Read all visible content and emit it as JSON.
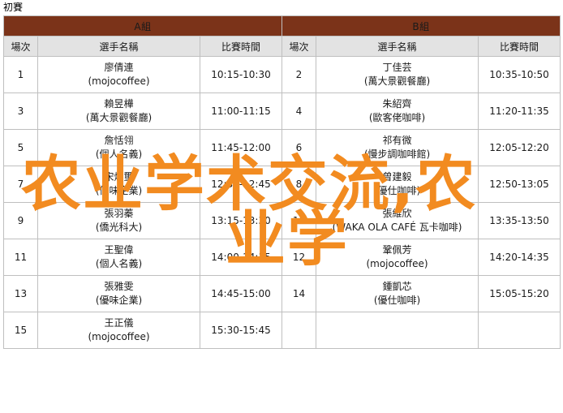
{
  "caption": "初賽",
  "colors": {
    "group_header_bg": "#7B3319",
    "group_header_text": "#FFFFFF",
    "column_header_bg": "#E3E3E3",
    "border": "#BFBFBF",
    "watermark": "#F28B20"
  },
  "watermark": {
    "line1": "农业学术交流,农",
    "line2": "业学"
  },
  "groups": [
    {
      "title": "A組",
      "columns": [
        "場次",
        "選手名稱",
        "比賽時間"
      ],
      "rows": [
        {
          "no": "1",
          "name": "廖倩連",
          "org": "(mojocoffee)",
          "time": "10:15-10:30"
        },
        {
          "no": "3",
          "name": "賴昱樺",
          "org": "(萬大景觀餐廳)",
          "time": "11:00-11:15"
        },
        {
          "no": "5",
          "name": "詹恬翎",
          "org": "(個人名義)",
          "time": "11:45-12:00"
        },
        {
          "no": "7",
          "name": "宋燦璽",
          "org": "(優味企業)",
          "time": "12:30-12:45"
        },
        {
          "no": "9",
          "name": "張羽蓁",
          "org": "(僑光科大)",
          "time": "13:15-13:30"
        },
        {
          "no": "11",
          "name": "王聖偉",
          "org": "(個人名義)",
          "time": "14:00-14:15"
        },
        {
          "no": "13",
          "name": "張雅雯",
          "org": "(優味企業)",
          "time": "14:45-15:00"
        },
        {
          "no": "15",
          "name": "王正儀",
          "org": "(mojocoffee)",
          "time": "15:30-15:45"
        }
      ]
    },
    {
      "title": "B組",
      "columns": [
        "場次",
        "選手名稱",
        "比賽時間"
      ],
      "rows": [
        {
          "no": "2",
          "name": "丁佳芸",
          "org": "(萬大景觀餐廳)",
          "time": "10:35-10:50"
        },
        {
          "no": "4",
          "name": "朱紹齊",
          "org": "(歐客佬咖啡)",
          "time": "11:20-11:35"
        },
        {
          "no": "6",
          "name": "祁有微",
          "org": "(慢步調咖啡館)",
          "time": "12:05-12:20"
        },
        {
          "no": "8",
          "name": "曾建毅",
          "org": "(優仕咖啡)",
          "time": "12:50-13:05"
        },
        {
          "no": "10",
          "name": "張維欣",
          "org": "(WAKA OLA CAFÉ 瓦卡咖啡)",
          "time": "13:35-13:50"
        },
        {
          "no": "12",
          "name": "鞏佩芳",
          "org": "(mojocoffee)",
          "time": "14:20-14:35"
        },
        {
          "no": "14",
          "name": "鍾凱芯",
          "org": "(優仕咖啡)",
          "time": "15:05-15:20"
        },
        {
          "no": "",
          "name": "",
          "org": "",
          "time": ""
        }
      ]
    }
  ]
}
